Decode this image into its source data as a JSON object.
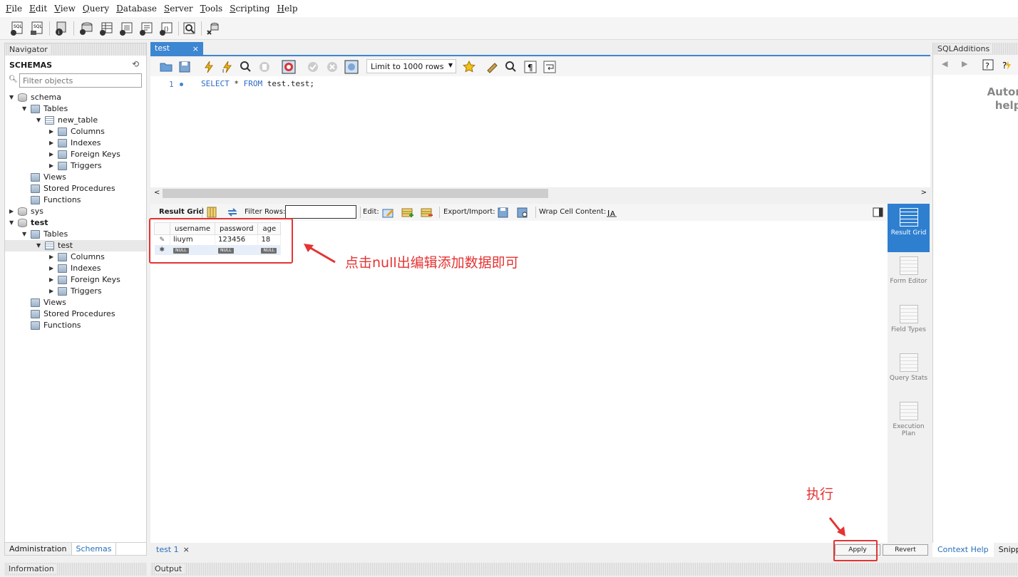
{
  "menu": [
    "File",
    "Edit",
    "View",
    "Query",
    "Database",
    "Server",
    "Tools",
    "Scripting",
    "Help"
  ],
  "navigator": {
    "title": "Navigator",
    "schemas_label": "SCHEMAS",
    "filter_placeholder": "Filter objects",
    "tree": [
      {
        "label": "schema",
        "level": 0,
        "arrow": "▼",
        "icon": "database-icon",
        "bold": false
      },
      {
        "label": "Tables",
        "level": 1,
        "arrow": "▼",
        "icon": "tables-folder-icon"
      },
      {
        "label": "new_table",
        "level": 2,
        "arrow": "▼",
        "icon": "table-icon"
      },
      {
        "label": "Columns",
        "level": 3,
        "arrow": "▶",
        "icon": "columns-icon"
      },
      {
        "label": "Indexes",
        "level": 3,
        "arrow": "▶",
        "icon": "indexes-icon"
      },
      {
        "label": "Foreign Keys",
        "level": 3,
        "arrow": "▶",
        "icon": "foreign-keys-icon"
      },
      {
        "label": "Triggers",
        "level": 3,
        "arrow": "▶",
        "icon": "triggers-icon"
      },
      {
        "label": "Views",
        "level": 1,
        "arrow": "",
        "icon": "views-icon"
      },
      {
        "label": "Stored Procedures",
        "level": 1,
        "arrow": "",
        "icon": "procedures-icon"
      },
      {
        "label": "Functions",
        "level": 1,
        "arrow": "",
        "icon": "functions-icon"
      },
      {
        "label": "sys",
        "level": 0,
        "arrow": "▶",
        "icon": "database-icon"
      },
      {
        "label": "test",
        "level": 0,
        "arrow": "▼",
        "icon": "database-icon",
        "bold": true
      },
      {
        "label": "Tables",
        "level": 1,
        "arrow": "▼",
        "icon": "tables-folder-icon"
      },
      {
        "label": "test",
        "level": 2,
        "arrow": "▼",
        "icon": "table-icon",
        "selected": true
      },
      {
        "label": "Columns",
        "level": 3,
        "arrow": "▶",
        "icon": "columns-icon"
      },
      {
        "label": "Indexes",
        "level": 3,
        "arrow": "▶",
        "icon": "indexes-icon"
      },
      {
        "label": "Foreign Keys",
        "level": 3,
        "arrow": "▶",
        "icon": "foreign-keys-icon"
      },
      {
        "label": "Triggers",
        "level": 3,
        "arrow": "▶",
        "icon": "triggers-icon"
      },
      {
        "label": "Views",
        "level": 1,
        "arrow": "",
        "icon": "views-icon"
      },
      {
        "label": "Stored Procedures",
        "level": 1,
        "arrow": "",
        "icon": "procedures-icon"
      },
      {
        "label": "Functions",
        "level": 1,
        "arrow": "",
        "icon": "functions-icon"
      }
    ],
    "tabs": {
      "administration": "Administration",
      "schemas": "Schemas"
    },
    "information": "Information"
  },
  "query_tab": {
    "label": "test",
    "close": "×"
  },
  "editor_toolbar": {
    "limit": "Limit to 1000 rows"
  },
  "editor": {
    "line_number": "1",
    "sql": {
      "select": "SELECT",
      "star": " * ",
      "from": "FROM",
      "rest": " test.test;"
    }
  },
  "result_toolbar": {
    "result_grid": "Result Grid",
    "filter_rows": "Filter Rows:",
    "edit": "Edit:",
    "export_import": "Export/Import:",
    "wrap_cell": "Wrap Cell Content:"
  },
  "result_grid": {
    "columns": [
      "username",
      "password",
      "age"
    ],
    "rows": [
      [
        "liuym",
        "123456",
        "18"
      ]
    ],
    "new_row": [
      "NULL",
      "NULL",
      "NULL"
    ]
  },
  "side_panel": {
    "result_grid": "Result Grid",
    "form_editor": "Form Editor",
    "field_types": "Field Types",
    "query_stats": "Query Stats",
    "execution_plan": "Execution Plan"
  },
  "annotations": {
    "grid_note": "点击null出编辑添加数据即可",
    "execute_note": "执行"
  },
  "bottom_bar": {
    "tab": "test 1",
    "close": "×",
    "apply": "Apply",
    "revert": "Revert"
  },
  "output": "Output",
  "sql_additions": {
    "title": "SQLAdditions",
    "text_line1": "Automatic c",
    "text_line2": "help for t",
    "tabs": {
      "context_help": "Context Help",
      "snippets": "Snippets"
    }
  },
  "colors": {
    "accent": "#3d86d1",
    "annotation": "#e53333"
  }
}
